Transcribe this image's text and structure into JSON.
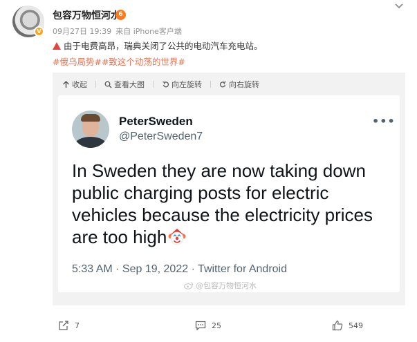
{
  "post": {
    "username": "包容万物恒河水",
    "level_badge": "6",
    "date": "09月27日 19:39",
    "source": "来自 iPhone客户端",
    "text": "由于电费高昂，瑞典关闭了公共的电动汽车充电站。",
    "hashtags": [
      "#俄乌局势#",
      "#致这个动荡的世界#"
    ]
  },
  "image_toolbar": {
    "collapse": "收起",
    "view_large": "查看大图",
    "rotate_left": "向左旋转",
    "rotate_right": "向右旋转"
  },
  "tweet": {
    "name": "PeterSweden",
    "handle": "@PeterSweden7",
    "more": "•••",
    "body": "In Sweden they are now taking down public charging posts for electric vehicles because the electricity prices are too high",
    "footer": "5:33 AM · Sep 19, 2022 · Twitter for Android",
    "watermark": "@包容万物恒河水"
  },
  "actions": {
    "repost_count": "7",
    "comment_count": "25",
    "like_count": "549"
  },
  "colors": {
    "hashtag": "#eb7350",
    "panel_bg": "#f2f2f2",
    "warning": "#e64340"
  }
}
